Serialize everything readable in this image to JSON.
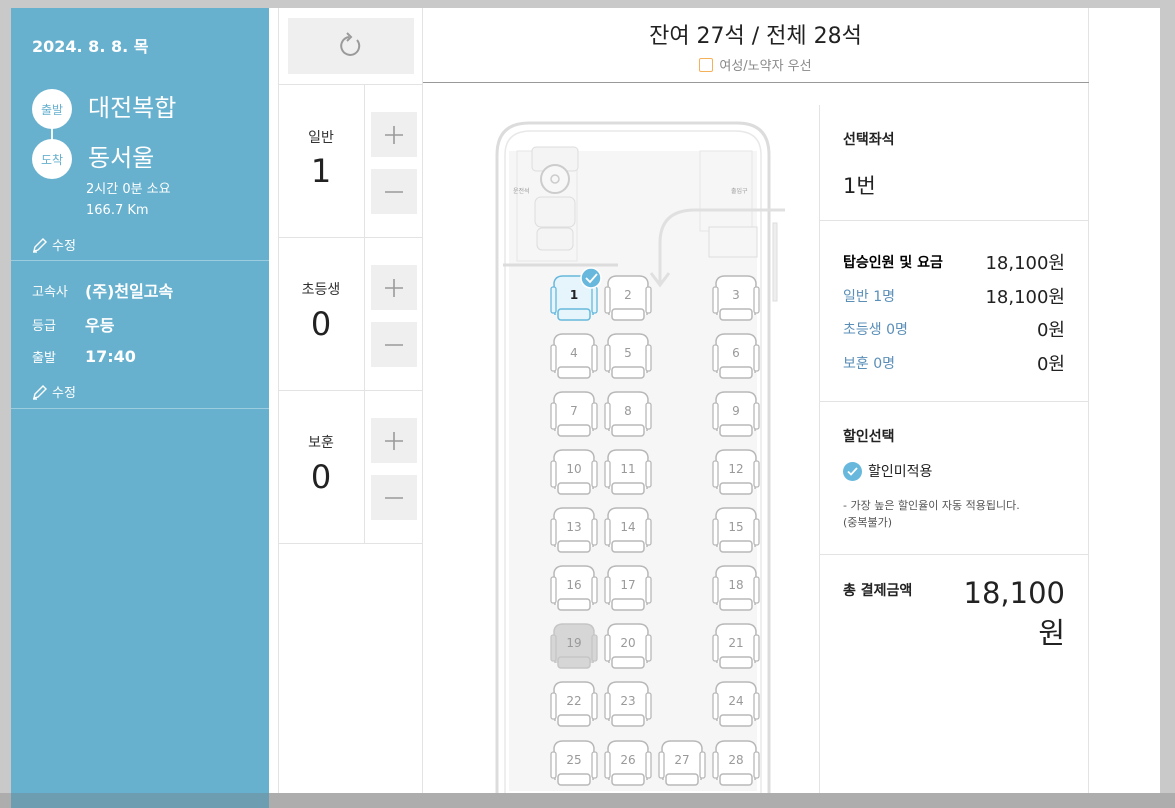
{
  "sidebar": {
    "date": "2024. 8. 8. 목",
    "departure_badge": "출발",
    "arrival_badge": "도착",
    "departure_city": "대전복합",
    "arrival_city": "동서울",
    "duration": "2시간 0분 소요",
    "distance": "166.7 Km",
    "edit_label": "수정",
    "company_label": "고속사",
    "company_value": "(주)천일고속",
    "grade_label": "등급",
    "grade_value": "우등",
    "depart_label": "출발",
    "depart_time": "17:40"
  },
  "passengers": [
    {
      "type": "일반",
      "count": "1"
    },
    {
      "type": "초등생",
      "count": "0"
    },
    {
      "type": "보훈",
      "count": "0"
    }
  ],
  "header": {
    "seat_status": "잔여 27석 / 전체 28석",
    "priority_label": "여성/노약자 우선"
  },
  "bus": {
    "driver_label": "운전석",
    "door_label": "출입구",
    "selected_seat": 1,
    "sold_seat": 19,
    "seats": [
      "1",
      "2",
      "3",
      "4",
      "5",
      "6",
      "7",
      "8",
      "9",
      "10",
      "11",
      "12",
      "13",
      "14",
      "15",
      "16",
      "17",
      "18",
      "19",
      "20",
      "21",
      "22",
      "23",
      "24",
      "25",
      "26",
      "27",
      "28"
    ]
  },
  "summary": {
    "selected_label": "선택좌석",
    "selected_value": "1번",
    "fare_title": "탑승인원 및 요금",
    "fare_total": "18,100원",
    "fare_rows": [
      {
        "label": "일반 1명",
        "value": "18,100원"
      },
      {
        "label": "초등생 0명",
        "value": "0원"
      },
      {
        "label": "보훈 0명",
        "value": "0원"
      }
    ],
    "discount_title": "할인선택",
    "discount_option": "할인미적용",
    "discount_note": "- 가장 높은 할인율이 자동 적용됩니다.",
    "discount_note2": "(중복불가)",
    "total_label": "총 결제금액",
    "total_value": "18,100원"
  },
  "colors": {
    "sidebar": "#67b1cf",
    "selected_seat": "#67b8dc",
    "priority": "#f5b05a"
  }
}
